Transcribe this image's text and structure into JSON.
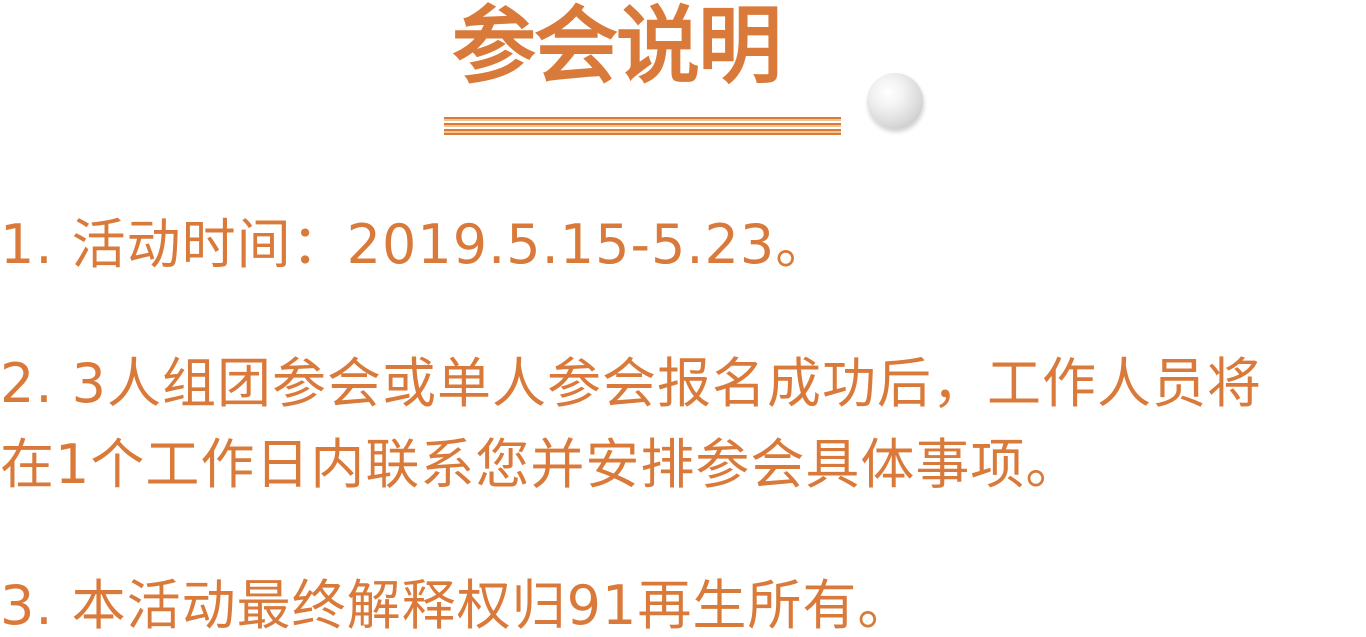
{
  "header": {
    "title": "参会说明"
  },
  "notes": [
    "1. 活动时间：2019.5.15-5.23。",
    "2. 3人组团参会或单人参会报名成功后，工作人员将",
    "在1个工作日内联系您并安排参会具体事项。",
    "3. 本活动最终解释权归91再生所有。"
  ],
  "colors": {
    "accent": "#d97a3a",
    "accent_light": "#f2c58d",
    "background": "#ffffff"
  }
}
